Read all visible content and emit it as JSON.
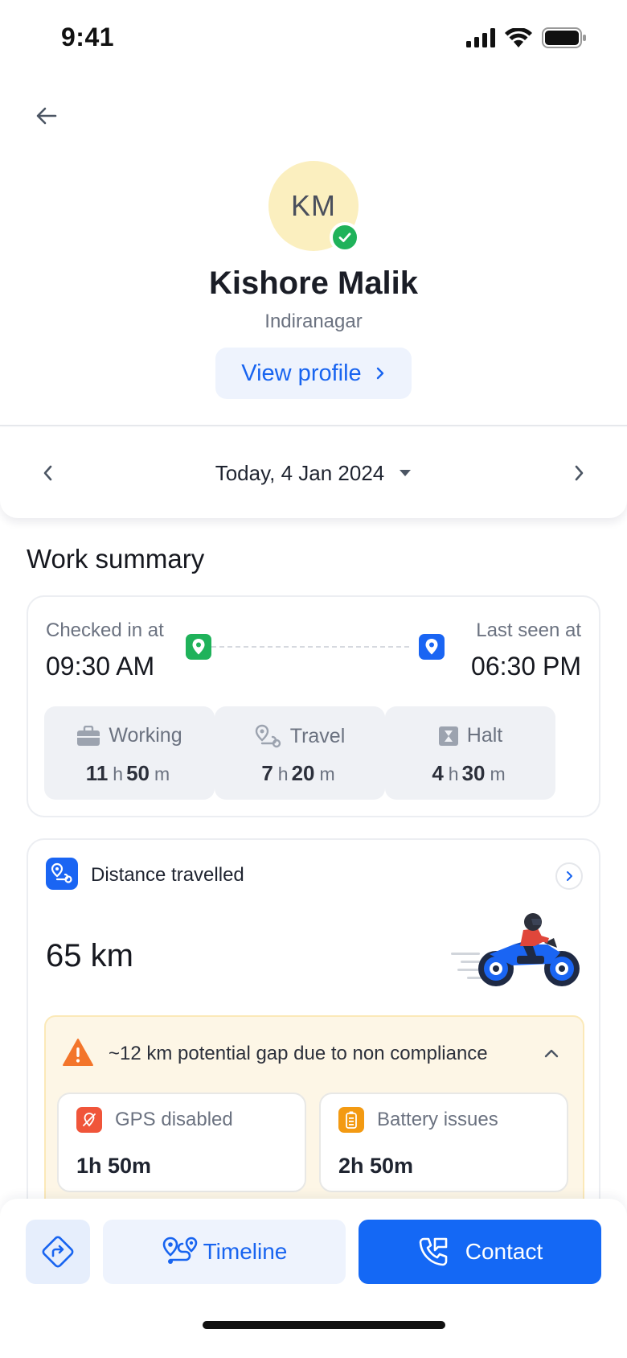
{
  "status_bar": {
    "time": "9:41"
  },
  "profile": {
    "initials": "KM",
    "name": "Kishore Malik",
    "location": "Indiranagar",
    "view_profile_label": "View profile"
  },
  "date_nav": {
    "date_label": "Today, 4 Jan 2024"
  },
  "work_summary": {
    "title": "Work summary",
    "checked_in_label": "Checked in at",
    "checked_in_time": "09:30 AM",
    "last_seen_label": "Last seen at",
    "last_seen_time": "06:30 PM",
    "stats": [
      {
        "label": "Working",
        "hours": "11",
        "minutes": "50",
        "icon": "briefcase-icon"
      },
      {
        "label": "Travel",
        "hours": "7",
        "minutes": "20",
        "icon": "route-pin-icon"
      },
      {
        "label": "Halt",
        "hours": "4",
        "minutes": "30",
        "icon": "hourglass-icon"
      }
    ],
    "unit_h": "h",
    "unit_m": "m"
  },
  "distance": {
    "title": "Distance travelled",
    "value": "65 km",
    "gap_text": "~12 km potential gap due to non compliance",
    "issues": [
      {
        "label": "GPS disabled",
        "value": "1h 50m",
        "icon": "gps-off-icon",
        "color": "#f0553a"
      },
      {
        "label": "Battery issues",
        "value": "2h 50m",
        "icon": "battery-icon",
        "color": "#f39a12"
      }
    ]
  },
  "bottom_bar": {
    "timeline_label": "Timeline",
    "contact_label": "Contact"
  },
  "colors": {
    "accent": "#1468f5",
    "success": "#1fb25a",
    "warning": "#f3752b",
    "avatar_bg": "#fbefbf"
  }
}
